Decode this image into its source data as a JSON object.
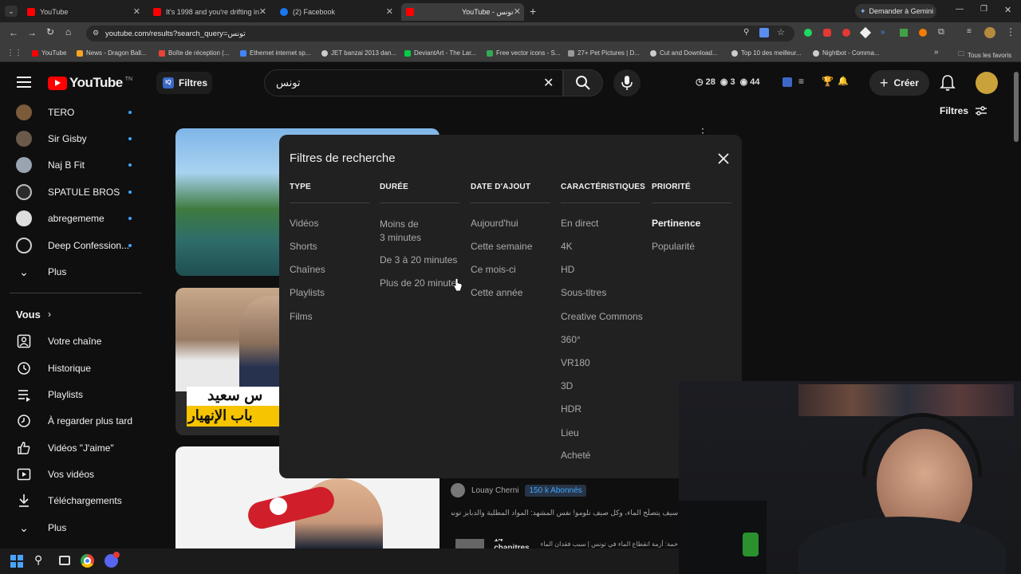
{
  "browser": {
    "tabs": [
      {
        "title": "YouTube",
        "color": "#ff0000"
      },
      {
        "title": "It's 1998 and you're drifting in",
        "color": "#ff0000"
      },
      {
        "title": "(2) Facebook",
        "color": "#1877f2"
      },
      {
        "title": "YouTube - تونس",
        "color": "#ff0000"
      }
    ],
    "gemini_label": "Demander à Gemini",
    "url": "youtube.com/results?search_query=تونس",
    "bookmarks": [
      {
        "label": "YouTube",
        "color": "#ff0000"
      },
      {
        "label": "News - Dragon Ball...",
        "color": "#f5a623"
      },
      {
        "label": "Boîte de réception (...",
        "color": "#ea4335"
      },
      {
        "label": "Ethernet internet sp...",
        "color": "#4285f4"
      },
      {
        "label": "JET banzai 2013 dan...",
        "color": "#cccccc"
      },
      {
        "label": "DeviantArt - The Lar...",
        "color": "#05cc47"
      },
      {
        "label": "Free vector icons - S...",
        "color": "#34a853"
      },
      {
        "label": "27+ Pet Pictures | D...",
        "color": "#999999"
      },
      {
        "label": "Cut and Download...",
        "color": "#cccccc"
      },
      {
        "label": "Top 10 des meilleur...",
        "color": "#cccccc"
      },
      {
        "label": "Nightbot - Comma...",
        "color": "#cccccc"
      }
    ],
    "all_bookmarks": "Tous les favoris"
  },
  "youtube": {
    "logo": "YouTube",
    "logo_country": "TN",
    "filters_chip": "Filtres",
    "search_value": "تونس",
    "stats": {
      "a": "28",
      "b": "3",
      "c": "44"
    },
    "create_label": "Créer",
    "filters_button": "Filtres"
  },
  "sidebar": {
    "subscriptions": [
      {
        "label": "TERO"
      },
      {
        "label": "Sir Gisby"
      },
      {
        "label": "Naj B Fit"
      },
      {
        "label": "SPATULE BROS"
      },
      {
        "label": "abregememe"
      },
      {
        "label": "Deep Confession..."
      }
    ],
    "more1": "Plus",
    "you_label": "Vous",
    "you_items": [
      {
        "label": "Votre chaîne",
        "icon": "channel-icon"
      },
      {
        "label": "Historique",
        "icon": "history-icon"
      },
      {
        "label": "Playlists",
        "icon": "playlists-icon"
      },
      {
        "label": "À regarder plus tard",
        "icon": "watch-later-icon"
      },
      {
        "label": "Vidéos \"J'aime\"",
        "icon": "like-icon"
      },
      {
        "label": "Vos vidéos",
        "icon": "your-videos-icon"
      },
      {
        "label": "Téléchargements",
        "icon": "download-icon"
      }
    ],
    "more2": "Plus"
  },
  "results": {
    "thumb2_text_top": "س سعيد",
    "thumb2_text_bottom": "باب الإنهيار",
    "channel": "Louay Cherni",
    "subs": "150 k Abonnés",
    "desc": "سيف يتصلّح الماء، وكل صيف نلومو! نفس المشهد: المواد المطلبة والدبابز تونس أزمة المياه في",
    "chapters": "14 chapitres",
    "chapters_desc": "خمة: أزمة انقطاع الماء في تونس | سبب فقدان الماء"
  },
  "modal": {
    "title": "Filtres de recherche",
    "columns": [
      {
        "header": "TYPE",
        "options": [
          "Vidéos",
          "Shorts",
          "Chaînes",
          "Playlists",
          "Films"
        ]
      },
      {
        "header": "DURÉE",
        "options": [
          "Moins de 3 minutes",
          "De 3 à 20 minutes",
          "Plus de 20 minutes"
        ]
      },
      {
        "header": "DATE D'AJOUT",
        "options": [
          "Aujourd'hui",
          "Cette semaine",
          "Ce mois-ci",
          "Cette année"
        ]
      },
      {
        "header": "CARACTÉRISTIQUES",
        "options": [
          "En direct",
          "4K",
          "HD",
          "Sous-titres",
          "Creative Commons",
          "360°",
          "VR180",
          "3D",
          "HDR",
          "Lieu",
          "Acheté"
        ]
      },
      {
        "header": "PRIORITÉ",
        "options": [
          "Pertinence",
          "Popularité"
        ]
      }
    ],
    "duration_short_line1": "Moins de",
    "duration_short_line2": "3 minutes",
    "selected": "Pertinence"
  }
}
